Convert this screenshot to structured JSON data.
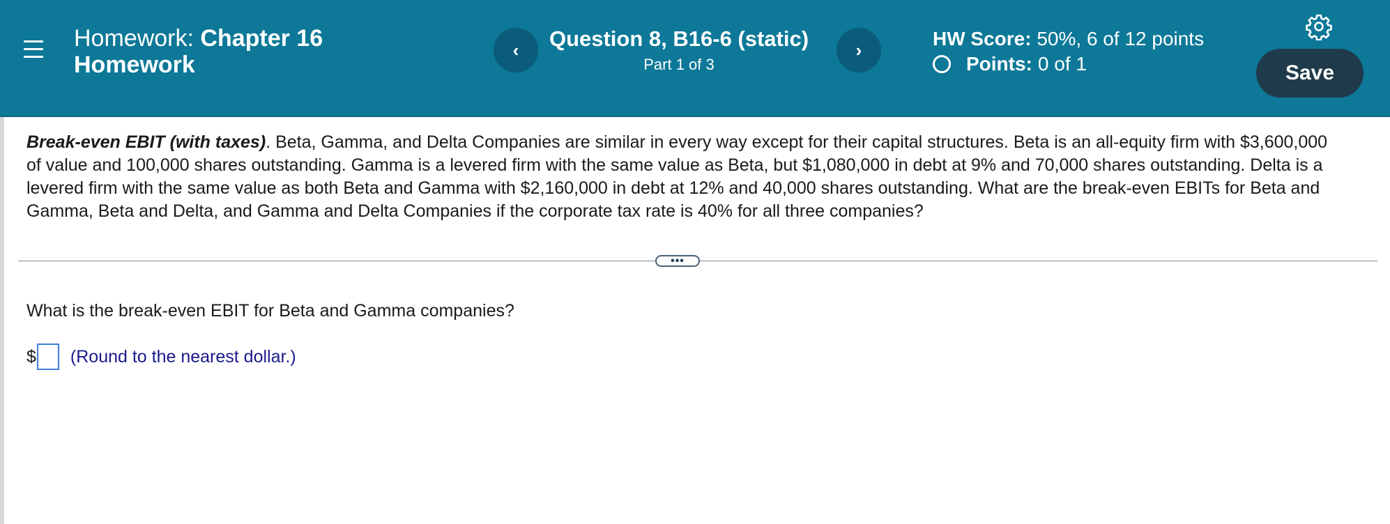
{
  "header": {
    "homework_prefix": "Homework:",
    "homework_title_line1": "Chapter 16",
    "homework_title_line2": "Homework",
    "prev_symbol": "‹",
    "next_symbol": "›",
    "question_title": "Question 8, B16-6 (static)",
    "question_part": "Part 1 of 3",
    "score_label": "HW Score:",
    "score_value": "50%, 6 of 12 points",
    "points_label": "Points:",
    "points_value": "0 of 1",
    "save_label": "Save"
  },
  "problem": {
    "lead": "Break-even EBIT (with taxes)",
    "text": ".  Beta, Gamma, and Delta Companies are similar in every way except for their capital structures.  Beta is an all-equity firm with $3,600,000 of value and 100,000 shares outstanding.  Gamma is a levered firm with the same value as Beta, but $1,080,000 in debt at 9% and 70,000 shares outstanding.  Delta is a levered firm with the same value as both Beta and Gamma with $2,160,000 in debt at 12% and 40,000 shares outstanding.  What are the break-even EBITs for Beta and Gamma, Beta and Delta, and Gamma and Delta Companies if the corporate tax rate is 40% for all three companies?"
  },
  "divider": {
    "expand_label": "•••"
  },
  "question": {
    "text": "What is the break-even EBIT for Beta and Gamma companies?",
    "currency": "$",
    "answer_value": "",
    "hint": "(Round to the nearest dollar.)"
  },
  "colors": {
    "header_bg": "#0d7898",
    "save_bg": "#1f3a4a",
    "hint": "#1a1a8c",
    "input_border": "#3a7fd5"
  },
  "icons": [
    "menu-icon",
    "chevron-left-icon",
    "chevron-right-icon",
    "gear-icon",
    "radio-circle-icon"
  ]
}
